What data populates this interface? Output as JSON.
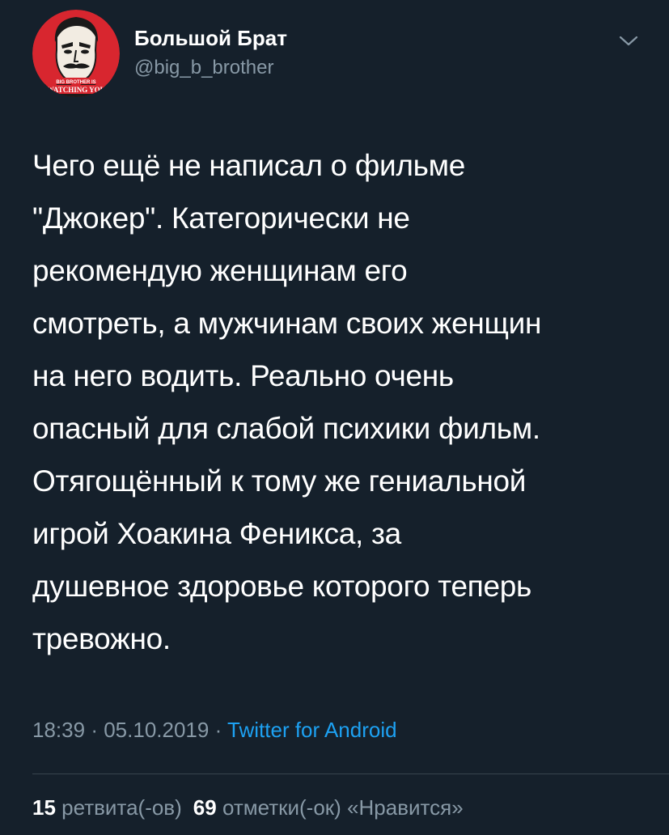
{
  "author": {
    "name": "Большой Брат",
    "handle": "@big_b_brother",
    "avatar_icon": "big-brother-poster-avatar",
    "avatar_text_top": "BIG BROTHER IS",
    "avatar_text_bottom": "WATCHING YOU"
  },
  "menu": {
    "icon": "chevron-down-icon"
  },
  "tweet": {
    "lines": [
      "Чего ещё не написал о фильме",
      "\"Джокер\". Категорически не",
      "рекомендую женщинам его",
      "смотреть, а мужчинам своих женщин",
      "на него водить. Реально очень",
      "опасный для слабой психики фильм.",
      "Отягощённый к тому же гениальной",
      "игрой Хоакина Феникса, за",
      "душевное здоровье которого теперь",
      "тревожно."
    ]
  },
  "meta": {
    "time": "18:39",
    "separator": "·",
    "date": "05.10.2019",
    "source": "Twitter for Android"
  },
  "stats": {
    "retweets_count": "15",
    "retweets_label": "ретвита(-ов)",
    "likes_count": "69",
    "likes_label": "отметки(-ок) «Нравится»"
  },
  "colors": {
    "background": "#15202b",
    "text": "#ffffff",
    "secondary": "#8899a6",
    "link": "#1da1f2",
    "avatar_red": "#d8262f"
  }
}
